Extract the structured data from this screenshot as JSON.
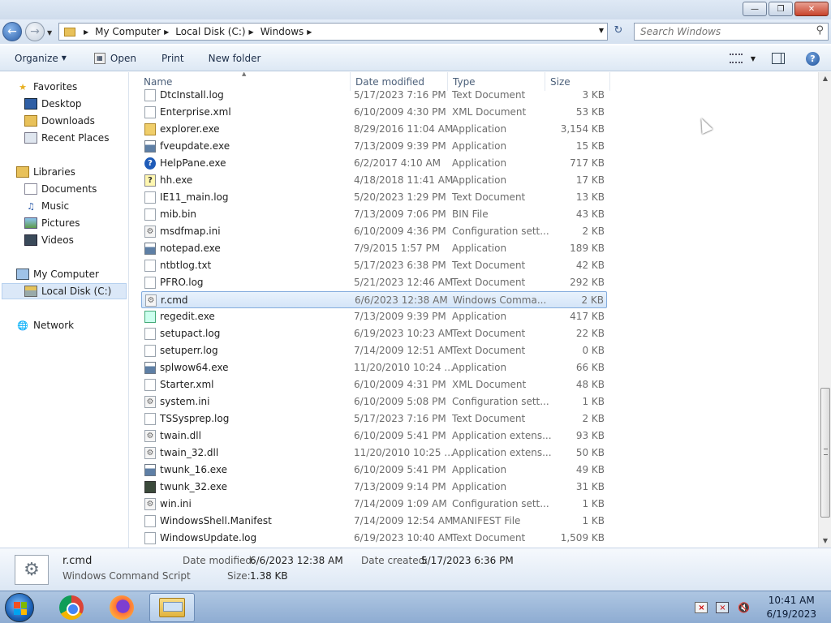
{
  "address": {
    "crumbs": [
      "My Computer",
      "Local Disk (C:)",
      "Windows"
    ]
  },
  "search": {
    "placeholder": "Search Windows"
  },
  "toolbar": {
    "organize": "Organize",
    "open": "Open",
    "print": "Print",
    "new_folder": "New folder"
  },
  "nav": {
    "favorites": "Favorites",
    "desktop": "Desktop",
    "downloads": "Downloads",
    "recent_places": "Recent Places",
    "libraries": "Libraries",
    "documents": "Documents",
    "music": "Music",
    "pictures": "Pictures",
    "videos": "Videos",
    "my_computer": "My Computer",
    "local_disk": "Local Disk (C:)",
    "network": "Network"
  },
  "columns": {
    "name": "Name",
    "date": "Date modified",
    "type": "Type",
    "size": "Size"
  },
  "files": [
    {
      "name": "DtcInstall.log",
      "date": "5/17/2023 7:16 PM",
      "type": "Text Document",
      "size": "3 KB",
      "icon": "doc"
    },
    {
      "name": "Enterprise.xml",
      "date": "6/10/2009 4:30 PM",
      "type": "XML Document",
      "size": "53 KB",
      "icon": "doc"
    },
    {
      "name": "explorer.exe",
      "date": "8/29/2016 11:04 AM",
      "type": "Application",
      "size": "3,154 KB",
      "icon": "explorer"
    },
    {
      "name": "fveupdate.exe",
      "date": "7/13/2009 9:39 PM",
      "type": "Application",
      "size": "15 KB",
      "icon": "app"
    },
    {
      "name": "HelpPane.exe",
      "date": "6/2/2017 4:10 AM",
      "type": "Application",
      "size": "717 KB",
      "icon": "help"
    },
    {
      "name": "hh.exe",
      "date": "4/18/2018 11:41 AM",
      "type": "Application",
      "size": "17 KB",
      "icon": "hh"
    },
    {
      "name": "IE11_main.log",
      "date": "5/20/2023 1:29 PM",
      "type": "Text Document",
      "size": "13 KB",
      "icon": "doc"
    },
    {
      "name": "mib.bin",
      "date": "7/13/2009 7:06 PM",
      "type": "BIN File",
      "size": "43 KB",
      "icon": "doc"
    },
    {
      "name": "msdfmap.ini",
      "date": "6/10/2009 4:36 PM",
      "type": "Configuration sett...",
      "size": "2 KB",
      "icon": "gear"
    },
    {
      "name": "notepad.exe",
      "date": "7/9/2015 1:57 PM",
      "type": "Application",
      "size": "189 KB",
      "icon": "app"
    },
    {
      "name": "ntbtlog.txt",
      "date": "5/17/2023 6:38 PM",
      "type": "Text Document",
      "size": "42 KB",
      "icon": "doc"
    },
    {
      "name": "PFRO.log",
      "date": "5/21/2023 12:46 AM",
      "type": "Text Document",
      "size": "292 KB",
      "icon": "doc"
    },
    {
      "name": "r.cmd",
      "date": "6/6/2023 12:38 AM",
      "type": "Windows Comma...",
      "size": "2 KB",
      "icon": "gear",
      "selected": true
    },
    {
      "name": "regedit.exe",
      "date": "7/13/2009 9:39 PM",
      "type": "Application",
      "size": "417 KB",
      "icon": "regedit"
    },
    {
      "name": "setupact.log",
      "date": "6/19/2023 10:23 AM",
      "type": "Text Document",
      "size": "22 KB",
      "icon": "doc"
    },
    {
      "name": "setuperr.log",
      "date": "7/14/2009 12:51 AM",
      "type": "Text Document",
      "size": "0 KB",
      "icon": "doc"
    },
    {
      "name": "splwow64.exe",
      "date": "11/20/2010 10:24 ...",
      "type": "Application",
      "size": "66 KB",
      "icon": "app"
    },
    {
      "name": "Starter.xml",
      "date": "6/10/2009 4:31 PM",
      "type": "XML Document",
      "size": "48 KB",
      "icon": "doc"
    },
    {
      "name": "system.ini",
      "date": "6/10/2009 5:08 PM",
      "type": "Configuration sett...",
      "size": "1 KB",
      "icon": "gear"
    },
    {
      "name": "TSSysprep.log",
      "date": "5/17/2023 7:16 PM",
      "type": "Text Document",
      "size": "2 KB",
      "icon": "doc"
    },
    {
      "name": "twain.dll",
      "date": "6/10/2009 5:41 PM",
      "type": "Application extens...",
      "size": "93 KB",
      "icon": "gear"
    },
    {
      "name": "twain_32.dll",
      "date": "11/20/2010 10:25 ...",
      "type": "Application extens...",
      "size": "50 KB",
      "icon": "gear"
    },
    {
      "name": "twunk_16.exe",
      "date": "6/10/2009 5:41 PM",
      "type": "Application",
      "size": "49 KB",
      "icon": "app"
    },
    {
      "name": "twunk_32.exe",
      "date": "7/13/2009 9:14 PM",
      "type": "Application",
      "size": "31 KB",
      "icon": "dark"
    },
    {
      "name": "win.ini",
      "date": "7/14/2009 1:09 AM",
      "type": "Configuration sett...",
      "size": "1 KB",
      "icon": "gear"
    },
    {
      "name": "WindowsShell.Manifest",
      "date": "7/14/2009 12:54 AM",
      "type": "MANIFEST File",
      "size": "1 KB",
      "icon": "doc"
    },
    {
      "name": "WindowsUpdate.log",
      "date": "6/19/2023 10:40 AM",
      "type": "Text Document",
      "size": "1,509 KB",
      "icon": "doc"
    }
  ],
  "details": {
    "name": "r.cmd",
    "type": "Windows Command Script",
    "date_modified_label": "Date modified:",
    "date_modified": "6/6/2023 12:38 AM",
    "size_label": "Size:",
    "size": "1.38 KB",
    "date_created_label": "Date created:",
    "date_created": "5/17/2023 6:36 PM"
  },
  "clock": {
    "time": "10:41 AM",
    "date": "6/19/2023"
  }
}
